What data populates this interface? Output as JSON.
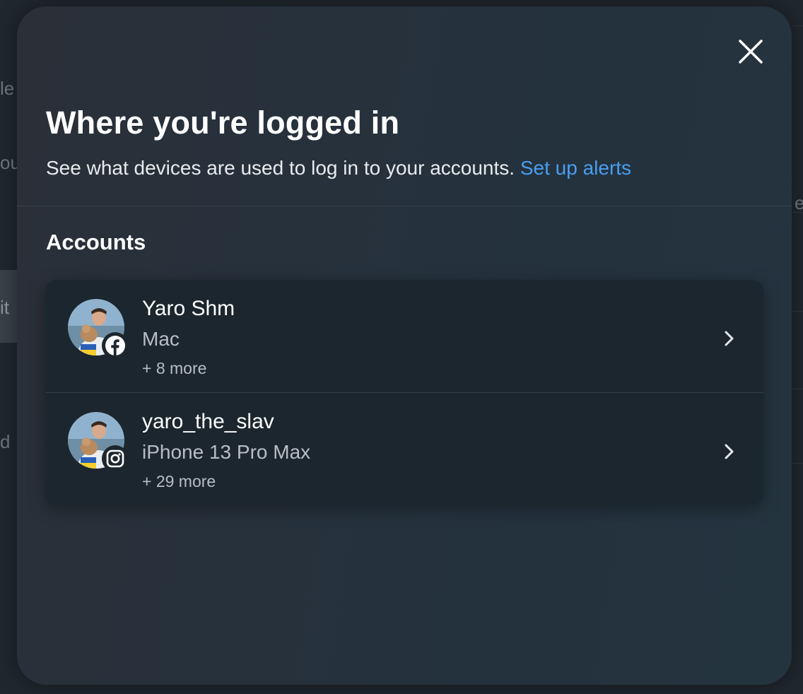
{
  "background": {
    "fragments": [
      "le",
      "ou",
      "it",
      "d",
      "e"
    ]
  },
  "modal": {
    "title": "Where you're logged in",
    "subtitle": "See what devices are used to log in to your accounts.",
    "alerts_link": "Set up alerts",
    "close_icon": "close-icon",
    "section_title": "Accounts",
    "accounts": [
      {
        "name": "Yaro Shm",
        "device": "Mac",
        "more": "+ 8 more",
        "platform_icon": "facebook-icon"
      },
      {
        "name": "yaro_the_slav",
        "device": "iPhone 13 Pro Max",
        "more": "+ 29 more",
        "platform_icon": "instagram-icon"
      }
    ]
  },
  "colors": {
    "link": "#4a9ef0",
    "card": "#1c262e",
    "text_primary": "#ffffff",
    "text_secondary": "#b7bec5"
  }
}
